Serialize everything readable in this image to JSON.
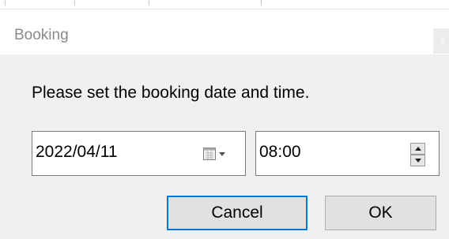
{
  "dialog": {
    "title": "Booking",
    "close_glyph": "x",
    "prompt": "Please set the booking date and time."
  },
  "date_picker": {
    "value": "2022/04/11",
    "icon": "calendar-dropdown-icon"
  },
  "time_picker": {
    "value": "08:00",
    "up_icon": "spin-up-icon",
    "down_icon": "spin-down-icon"
  },
  "buttons": {
    "cancel_label": "Cancel",
    "ok_label": "OK"
  },
  "colors": {
    "dialog_background": "#f0f0f0",
    "focus_border": "#0078d7",
    "button_face": "#e1e1e1"
  }
}
